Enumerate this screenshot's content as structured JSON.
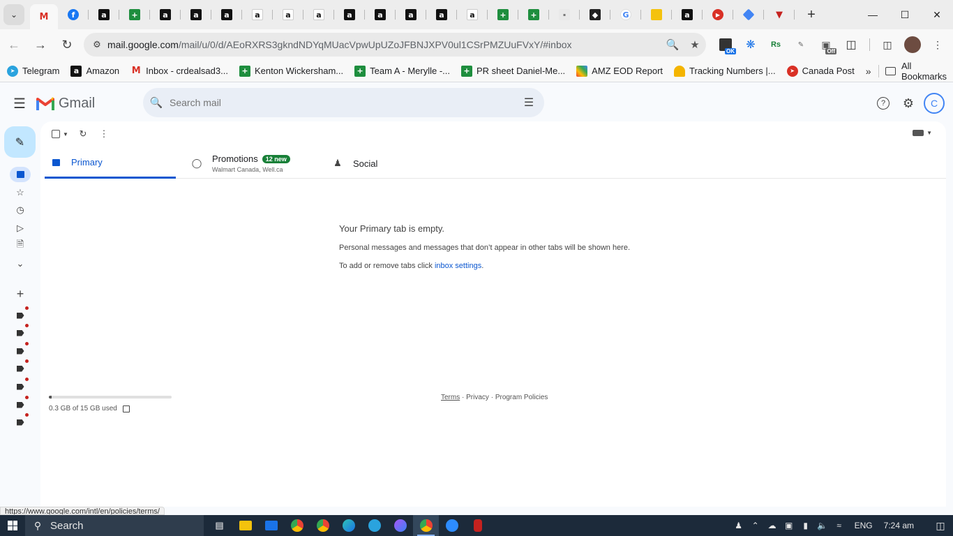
{
  "browser": {
    "url_host": "mail.google.com",
    "url_path": "/mail/u/0/d/AEoRXRS3gkndNDYqMUacVpwUpUZoJFBNJXPV0ul1CSrPMZUuFVxY/#inbox",
    "bookmarks": [
      {
        "label": "Telegram",
        "icon": "telegram-icon"
      },
      {
        "label": "Amazon",
        "icon": "amazon-icon"
      },
      {
        "label": "Inbox - crdealsad3...",
        "icon": "gmail-icon"
      },
      {
        "label": "Kenton Wickersham...",
        "icon": "sheets-icon"
      },
      {
        "label": "Team A - Merylle -...",
        "icon": "sheets-icon"
      },
      {
        "label": "PR sheet Daniel-Me...",
        "icon": "sheets-icon"
      },
      {
        "label": "AMZ EOD Report",
        "icon": "colorful-icon"
      },
      {
        "label": "Tracking Numbers |...",
        "icon": "taco-icon"
      },
      {
        "label": "Canada Post",
        "icon": "canada-post-icon"
      }
    ],
    "all_bookmarks_label": "All Bookmarks",
    "extension_badge_ok": "OK",
    "extension_badge_off": "Off",
    "ext_rs": "Rs"
  },
  "gmail": {
    "logo_text": "Gmail",
    "search_placeholder": "Search mail",
    "tabs": {
      "primary": "Primary",
      "promotions": "Promotions",
      "promotions_badge": "12 new",
      "promotions_senders": "Walmart Canada, Well.ca",
      "social": "Social"
    },
    "empty": {
      "title": "Your Primary tab is empty.",
      "line1": "Personal messages and messages that don’t appear in other tabs will be shown here.",
      "line2_prefix": "To add or remove tabs click ",
      "line2_link": "inbox settings",
      "line2_suffix": "."
    },
    "storage": {
      "text": "0.3 GB of 15 GB used",
      "used_fraction": 0.02
    },
    "footer": {
      "terms": "Terms",
      "sep": " · ",
      "privacy": "Privacy",
      "policies": "Program Policies"
    },
    "account_initial": "C"
  },
  "status_url": "https://www.google.com/intl/en/policies/terms/",
  "taskbar": {
    "search_label": "Search",
    "language": "ENG",
    "time": "7:24 am"
  }
}
